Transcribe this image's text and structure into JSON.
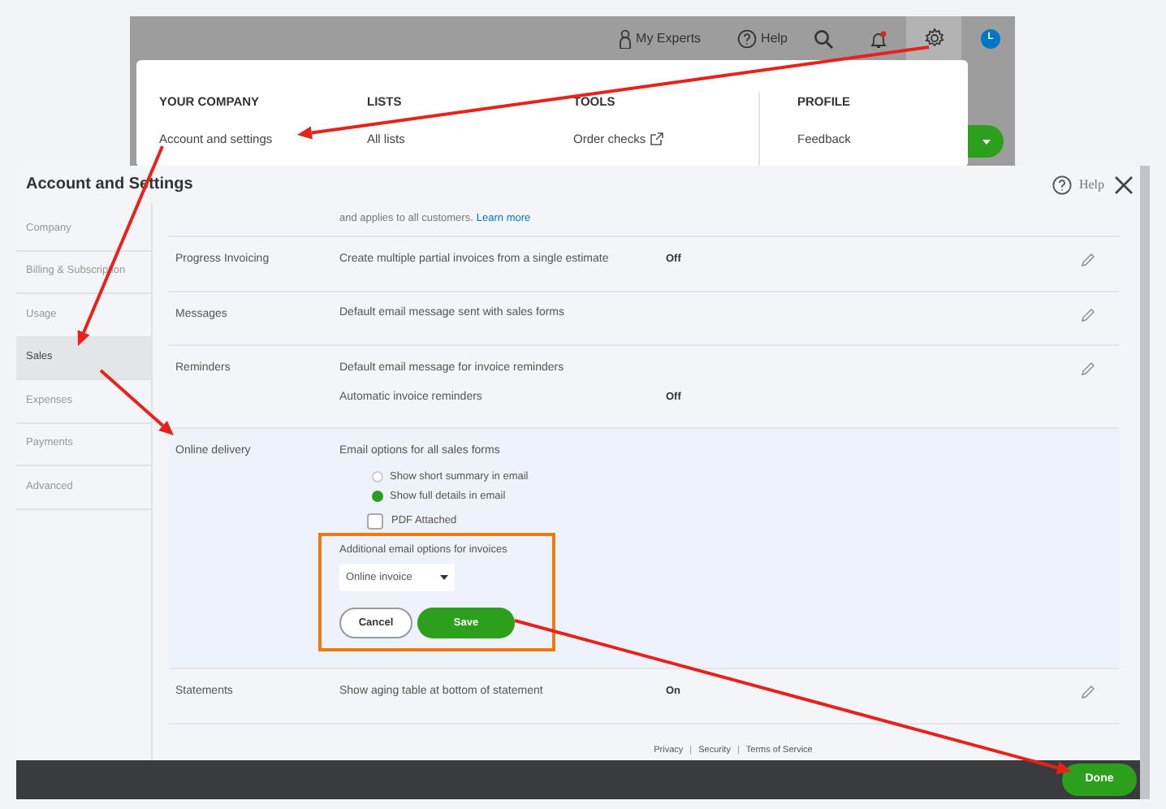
{
  "top_bar": {
    "experts": "My Experts",
    "help": "Help",
    "avatar": "L"
  },
  "settings_menu": {
    "columns": [
      {
        "heading": "YOUR COMPANY",
        "items": [
          {
            "label": "Account and settings",
            "external": false
          }
        ]
      },
      {
        "heading": "LISTS",
        "items": [
          {
            "label": "All lists",
            "external": false
          }
        ]
      },
      {
        "heading": "TOOLS",
        "items": [
          {
            "label": "Order checks",
            "external": true
          }
        ]
      },
      {
        "heading": "PROFILE",
        "items": [
          {
            "label": "Feedback",
            "external": false
          }
        ]
      }
    ]
  },
  "dialog": {
    "title": "Account and Settings",
    "help": "Help",
    "nav": [
      {
        "label": "Company",
        "selected": false
      },
      {
        "label": "Billing & Subscription",
        "selected": false
      },
      {
        "label": "Usage",
        "selected": false
      },
      {
        "label": "Sales",
        "selected": true
      },
      {
        "label": "Expenses",
        "selected": false
      },
      {
        "label": "Payments",
        "selected": false
      },
      {
        "label": "Advanced",
        "selected": false
      }
    ],
    "sections": [
      {
        "kind": "note",
        "text": "and applies to all customers.",
        "link": "Learn more"
      },
      {
        "kind": "setting",
        "label": "Progress Invoicing",
        "editable": true,
        "rows": [
          {
            "text": "Create multiple partial invoices from a single estimate",
            "value": "Off"
          }
        ]
      },
      {
        "kind": "setting",
        "label": "Messages",
        "editable": true,
        "rows": [
          {
            "text": "Default email message sent with sales forms"
          }
        ]
      },
      {
        "kind": "setting",
        "label": "Reminders",
        "editable": true,
        "rows": [
          {
            "text": "Default email message for invoice reminders"
          },
          {
            "text": "Automatic invoice reminders",
            "value": "Off"
          }
        ]
      },
      {
        "kind": "editing",
        "label": "Online delivery",
        "heading": "Email options for all sales forms",
        "options": [
          {
            "label": "Show short summary in email",
            "selected": false
          },
          {
            "label": "Show full details in email",
            "selected": true
          }
        ],
        "attachment": {
          "label": "PDF Attached",
          "checked": false
        },
        "additional_label": "Additional email options for invoices",
        "dropdown": "Online invoice",
        "cancel": "Cancel",
        "save": "Save"
      },
      {
        "kind": "setting",
        "label": "Statements",
        "editable": true,
        "rows": [
          {
            "text": "Show aging table at bottom of statement",
            "value": "On"
          }
        ]
      }
    ],
    "footer_links": [
      "Privacy",
      "Security",
      "Terms of Service"
    ],
    "footer_separators": [
      "|",
      "|"
    ],
    "done": "Done"
  }
}
